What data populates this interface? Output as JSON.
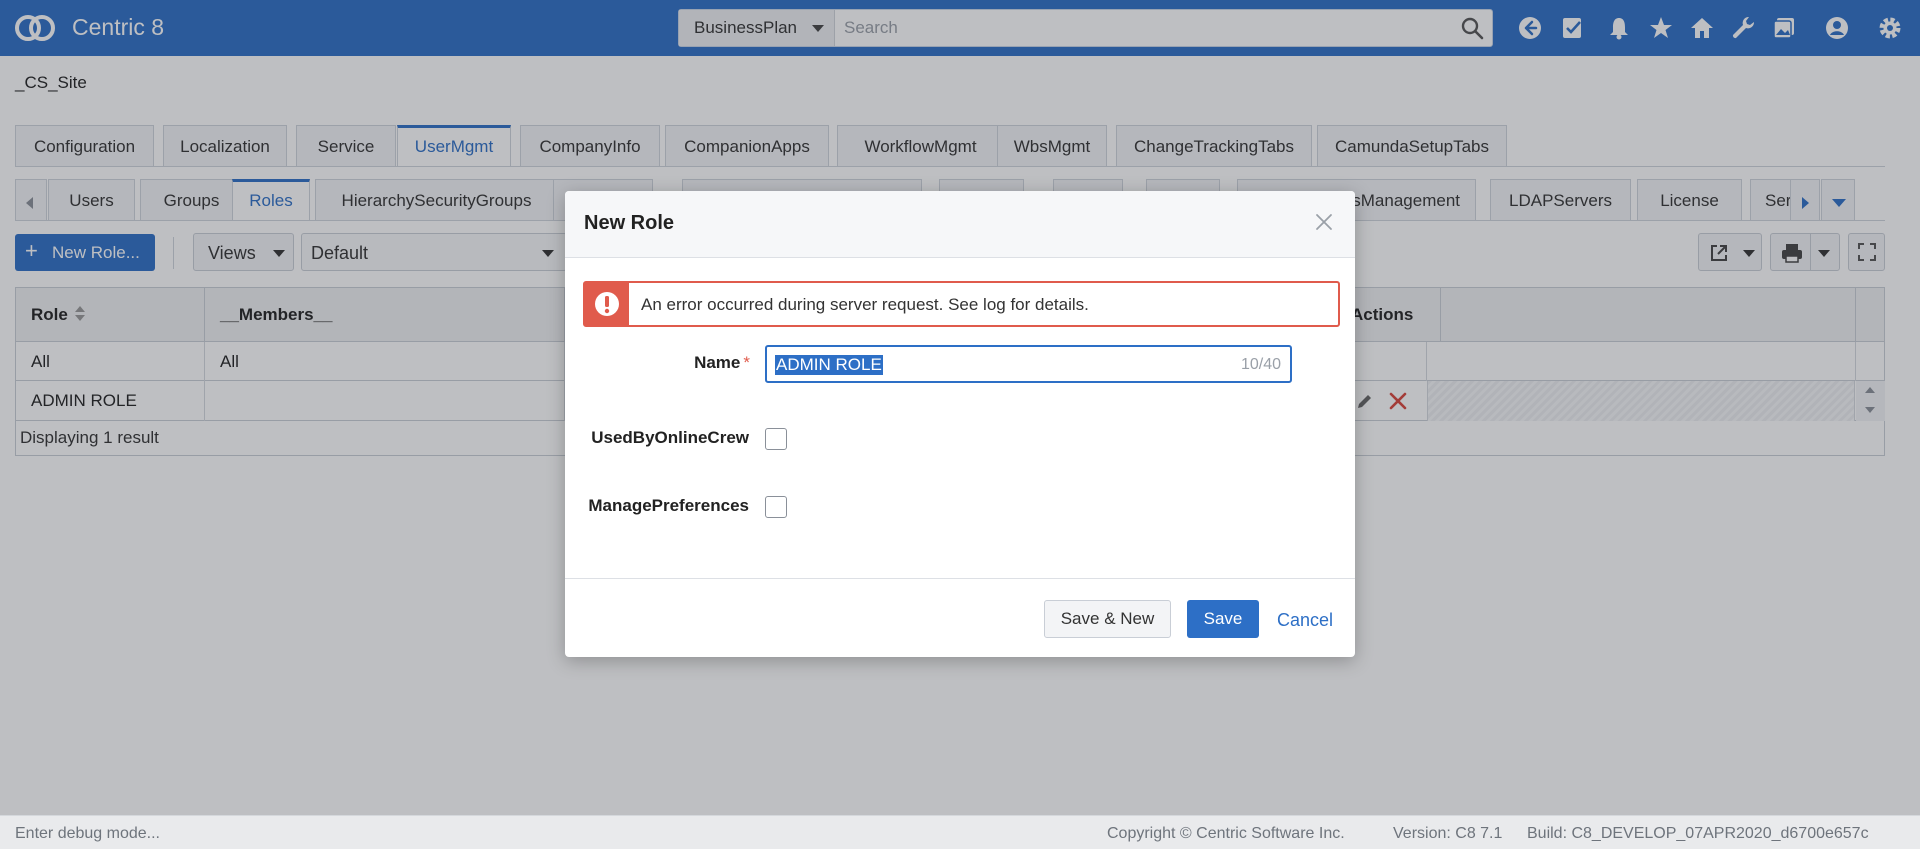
{
  "header": {
    "app_title": "Centric 8",
    "search_scope": "BusinessPlan",
    "search_placeholder": "Search",
    "icons": [
      "back-icon",
      "tasks-icon",
      "bell-icon",
      "star-icon",
      "home-icon",
      "wrench-icon",
      "gallery-icon",
      "user-icon",
      "gear-icon"
    ]
  },
  "site": "_CS_Site",
  "main_tabs": [
    "Configuration",
    "Localization",
    "Service",
    "UserMgmt",
    "CompanyInfo",
    "CompanionApps",
    "WorkflowMgmt",
    "WbsMgmt",
    "ChangeTrackingTabs",
    "CamundaSetupTabs"
  ],
  "main_tabs_active": "UserMgmt",
  "sub_tabs": [
    "Users",
    "Groups",
    "Roles",
    "HierarchySecurityGroups",
    "sManagement",
    "LDAPServers",
    "License",
    "Servi"
  ],
  "sub_tabs_active": "Roles",
  "toolbar": {
    "new_role": "New Role...",
    "views": "Views",
    "view_selected": "Default"
  },
  "table": {
    "columns": [
      "Role",
      "__Members__",
      "Actions"
    ],
    "filter_row": [
      "All",
      "All"
    ],
    "rows": [
      {
        "role": "ADMIN ROLE",
        "members": ""
      }
    ],
    "footer": "Displaying 1 result"
  },
  "dialog": {
    "title": "New Role",
    "error": "An error occurred during server request. See log for details.",
    "name_label": "Name",
    "name_value": "ADMIN ROLE",
    "name_counter": "10/40",
    "field_used_by_online_crew": "UsedByOnlineCrew",
    "field_manage_preferences": "ManagePreferences",
    "btn_save_new": "Save & New",
    "btn_save": "Save",
    "btn_cancel": "Cancel"
  },
  "status": {
    "debug": "Enter debug mode...",
    "copyright": "Copyright © Centric Software Inc.",
    "version": "Version: C8 7.1",
    "build": "Build: C8_DEVELOP_07APR2020_d6700e657c"
  },
  "colors": {
    "brand": "#2d6fc6",
    "error": "#e05b4c"
  }
}
